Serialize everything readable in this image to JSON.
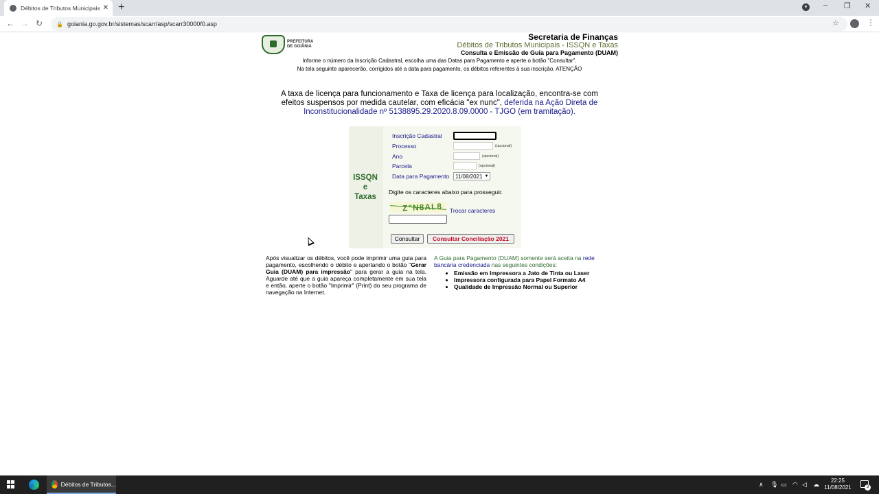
{
  "browser": {
    "tab_title": "Débitos de Tributos Municipais - ",
    "url": "goiania.go.gov.br/sistemas/scarr/asp/scarr30000f0.asp"
  },
  "header": {
    "logo_text": "PREFEITURA DE GOIÂNIA",
    "secretaria": "Secretaria de Finanças",
    "system_title": "Débitos de Tributos Municipais - ISSQN e Taxas",
    "subtitle": "Consulta e Emissão de Guia para Pagamento (DUAM)",
    "info_line1": "Informe o número da Inscrição Cadastral, escolha uma das Datas para Pagamento e aperte o botão \"Consultar\".",
    "info_line2": "Na tela seguinte aparecerão, corrigidos até a data para pagamento, os débitos referentes à sua inscrição. ATENÇÃO"
  },
  "notice": {
    "text": "A taxa de licença para funcionamento e Taxa de licença para localização, encontra-se com efeitos suspensos por medida cautelar, com eficácia \"ex nunc\", ",
    "link": "deferida na Ação Direta de Inconstitucionalidade nº 5138895.29.2020.8.09.0000 - TJGO (em tramitação)."
  },
  "form": {
    "side_label_1": "ISSQN",
    "side_label_2": "e",
    "side_label_3": "Taxas",
    "inscricao_label": "Inscrição Cadastral",
    "processo_label": "Processo",
    "ano_label": "Ano",
    "parcela_label": "Parcela",
    "data_label": "Data para Pagamento",
    "optional": "(opcional)",
    "data_value": "11/08/2021",
    "captcha_prompt": "Digite os caracteres abaixo para prosseguir.",
    "captcha_text": "Z\"N8AL8",
    "trocar": "Trocar caracteres",
    "btn_consultar": "Consultar",
    "btn_conciliacao": "Consultar Conciliação 2021"
  },
  "footer": {
    "left_text_1": "Após visualizar os débitos, você pode imprimir uma guia para pagamento, escolhendo o débito e apertando o botão \"",
    "left_bold": "Gerar Guia (DUAM) para impressão",
    "left_text_2": "\" para gerar a guia na tela. Aguarde até que a guia apareça completamente em sua tela e então, aperte o botão \"Imprimir\" (Print) do seu programa de navegação na Internet.",
    "right_text_1": "A Guia para Pagamento (DUAM) somente será aceita na ",
    "right_link": "rede bancária credenciada",
    "right_text_2": " nas seguintes condições:",
    "conditions": [
      "Emissão em Impressora a Jato de Tinta ou Laser",
      "Impressora configurada para Papel Formato A4",
      "Qualidade de Impressão Normal ou Superior"
    ]
  },
  "taskbar": {
    "app_label": "Débitos de Tributos...",
    "time": "22:25",
    "date": "11/08/2021",
    "notif_count": "3"
  }
}
